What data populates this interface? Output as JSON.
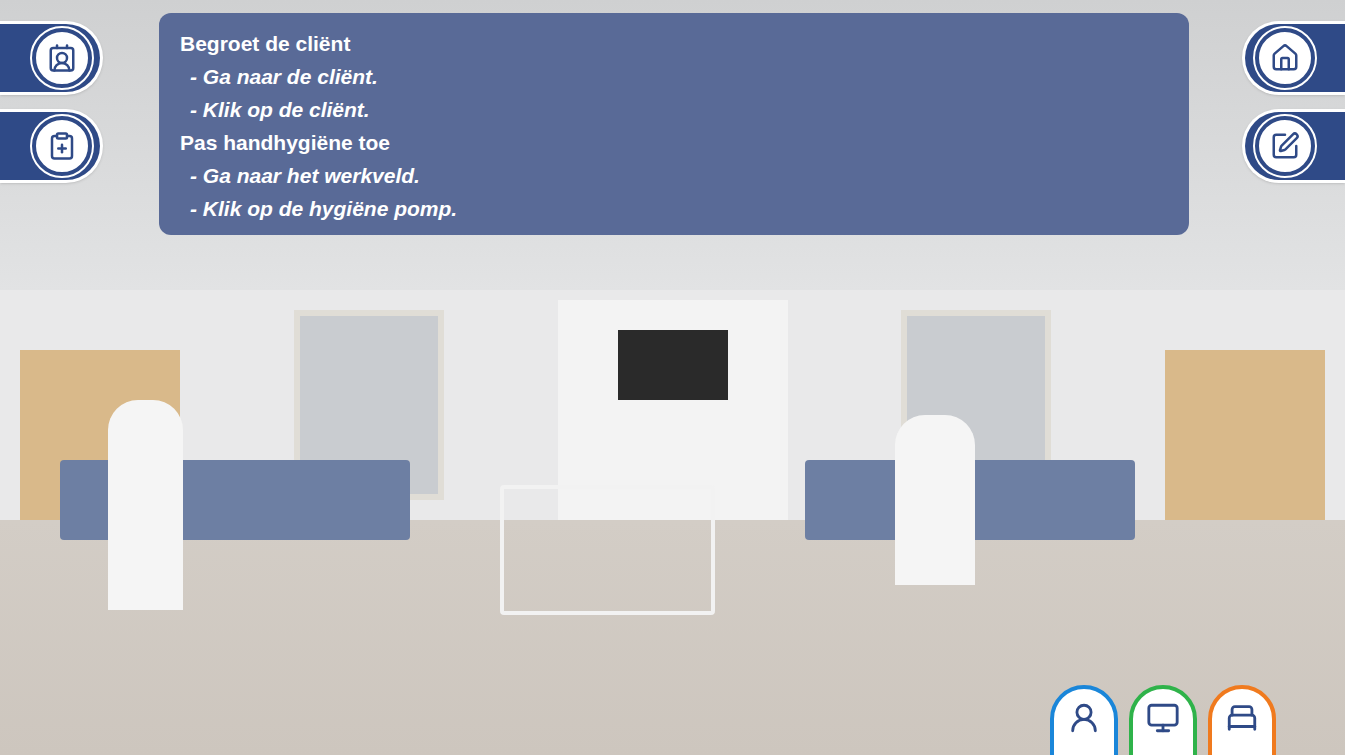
{
  "instructions": [
    {
      "title": "Begroet de cliënt",
      "steps": [
        "- Ga naar de cliënt.",
        "- Klik op de cliënt."
      ]
    },
    {
      "title": "Pas handhygiëne toe",
      "steps": [
        "- Ga naar het werkveld.",
        "- Klik op de hygiëne pomp."
      ]
    }
  ],
  "bottom_buttons": [
    {
      "name": "nurse",
      "color": "#1a86d9"
    },
    {
      "name": "trolley",
      "color": "#2fb34a"
    },
    {
      "name": "client",
      "color": "#f07a1e"
    }
  ]
}
